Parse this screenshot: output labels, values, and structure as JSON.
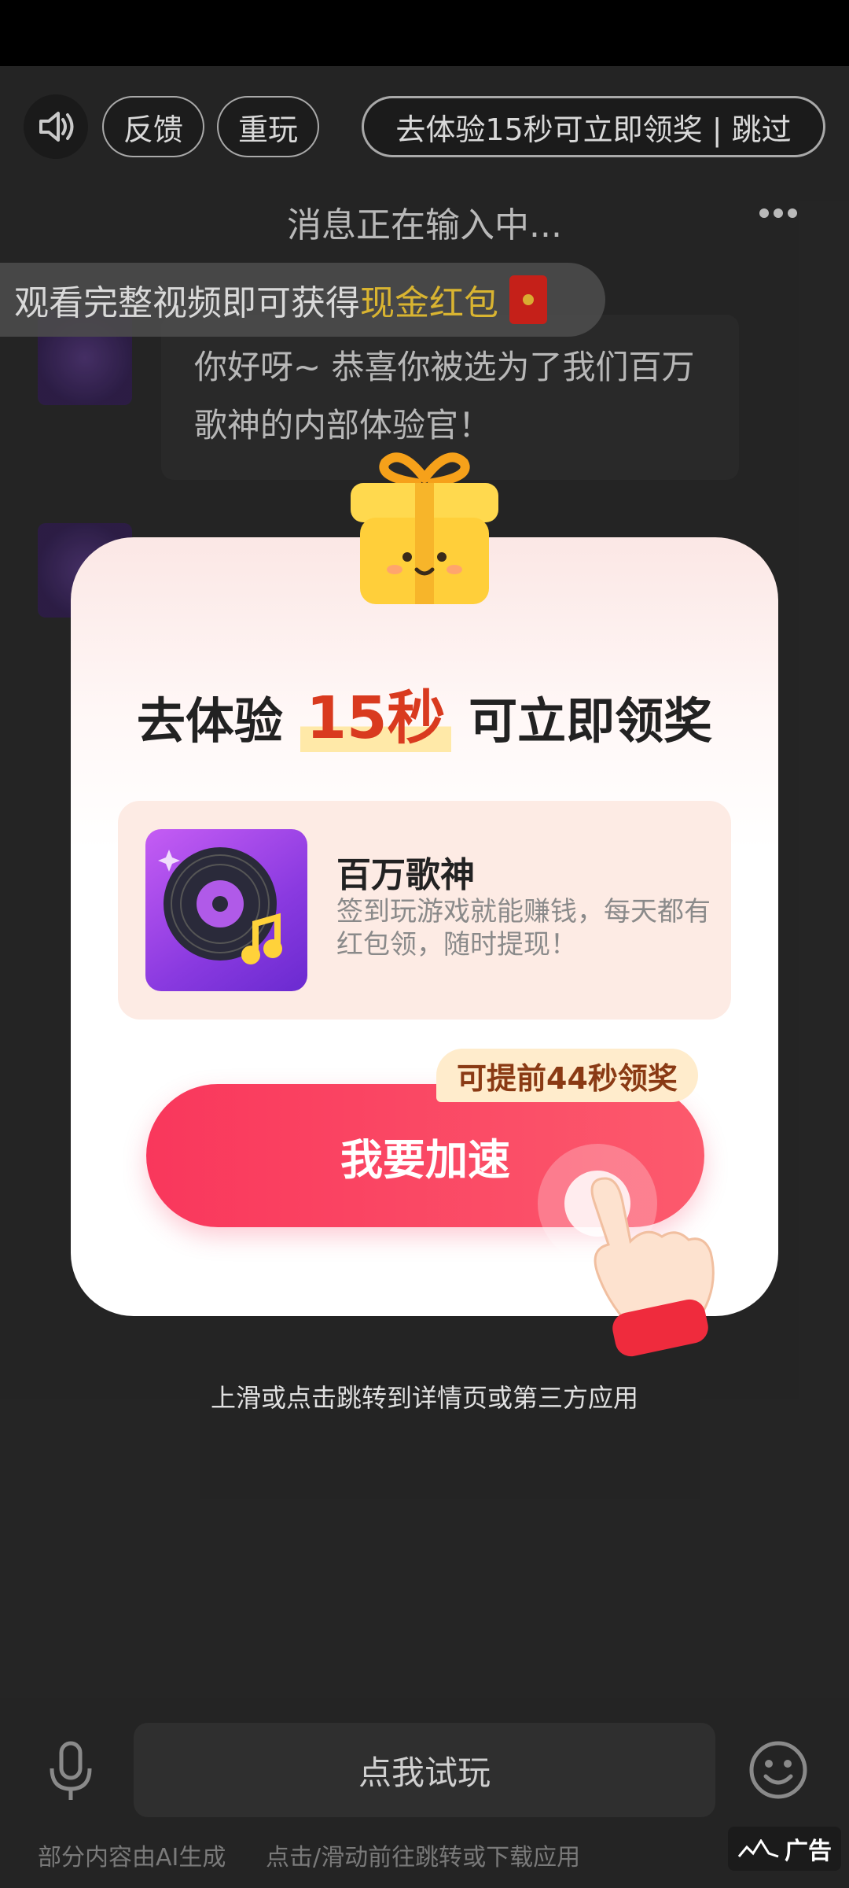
{
  "top": {
    "feedback_label": "反馈",
    "replay_label": "重玩",
    "skip_label": "去体验15秒可立即领奖 | 跳过"
  },
  "chat": {
    "title": "消息正在输入中...",
    "message": "你好呀~ 恭喜你被选为了我们百万歌神的内部体验官！"
  },
  "toast": {
    "text_prefix": "观看完整视频即可获得",
    "text_highlight": "现金红包"
  },
  "modal": {
    "title_prefix": "去体验",
    "title_number": "15秒",
    "title_suffix": "可立即领奖",
    "app_name": "百万歌神",
    "app_desc": "签到玩游戏就能赚钱，每天都有红包领，随时提现！",
    "tag_label": "可提前44秒领奖",
    "button_label": "我要加速"
  },
  "hint": "上滑或点击跳转到详情页或第三方应用",
  "bottom": {
    "try_label": "点我试玩",
    "ai_note": "部分内容由AI生成",
    "jump_note": "点击/滑动前往跳转或下载应用",
    "ad_label": "广告"
  },
  "colors": {
    "accent": "#f9375c",
    "highlight": "#ffd43a",
    "number": "#d93a1f"
  }
}
